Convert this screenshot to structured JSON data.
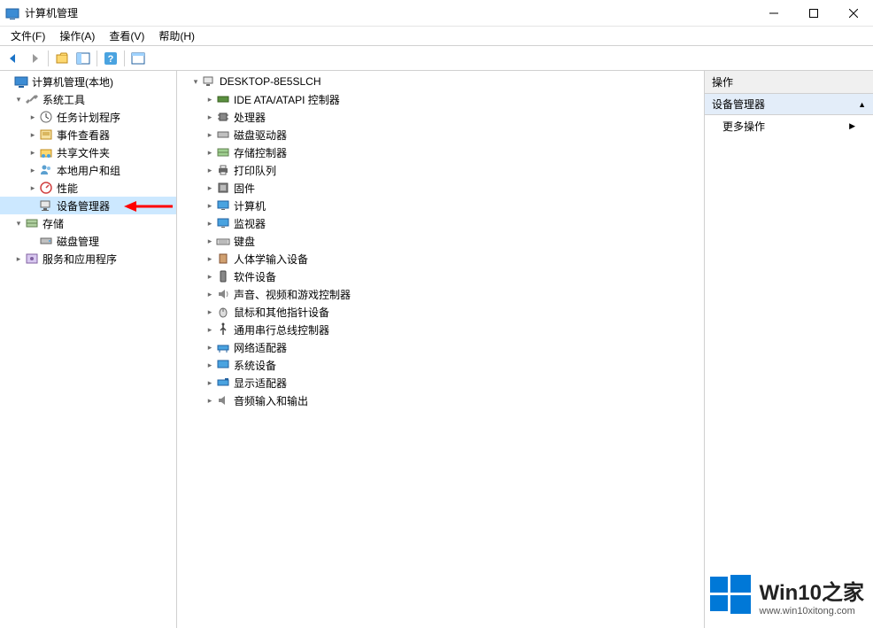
{
  "window": {
    "title": "计算机管理"
  },
  "menu": {
    "file": "文件(F)",
    "action": "操作(A)",
    "view": "查看(V)",
    "help": "帮助(H)"
  },
  "left_tree": {
    "root": "计算机管理(本地)",
    "system_tools": "系统工具",
    "task_scheduler": "任务计划程序",
    "event_viewer": "事件查看器",
    "shared_folders": "共享文件夹",
    "local_users": "本地用户和组",
    "performance": "性能",
    "device_manager": "设备管理器",
    "storage": "存储",
    "disk_management": "磁盘管理",
    "services_apps": "服务和应用程序"
  },
  "device_tree": {
    "computer": "DESKTOP-8E5SLCH",
    "ide": "IDE ATA/ATAPI 控制器",
    "processors": "处理器",
    "disk_drives": "磁盘驱动器",
    "storage_controllers": "存储控制器",
    "print_queues": "打印队列",
    "firmware": "固件",
    "computer_cat": "计算机",
    "monitors": "监视器",
    "keyboards": "键盘",
    "hid": "人体学输入设备",
    "software_devices": "软件设备",
    "sound": "声音、视频和游戏控制器",
    "mice": "鼠标和其他指针设备",
    "usb": "通用串行总线控制器",
    "network": "网络适配器",
    "system_devices": "系统设备",
    "display": "显示适配器",
    "audio_io": "音频输入和输出"
  },
  "actions": {
    "header": "操作",
    "section": "设备管理器",
    "more": "更多操作"
  },
  "watermark": {
    "title": "Win10之家",
    "url": "www.win10xitong.com"
  }
}
